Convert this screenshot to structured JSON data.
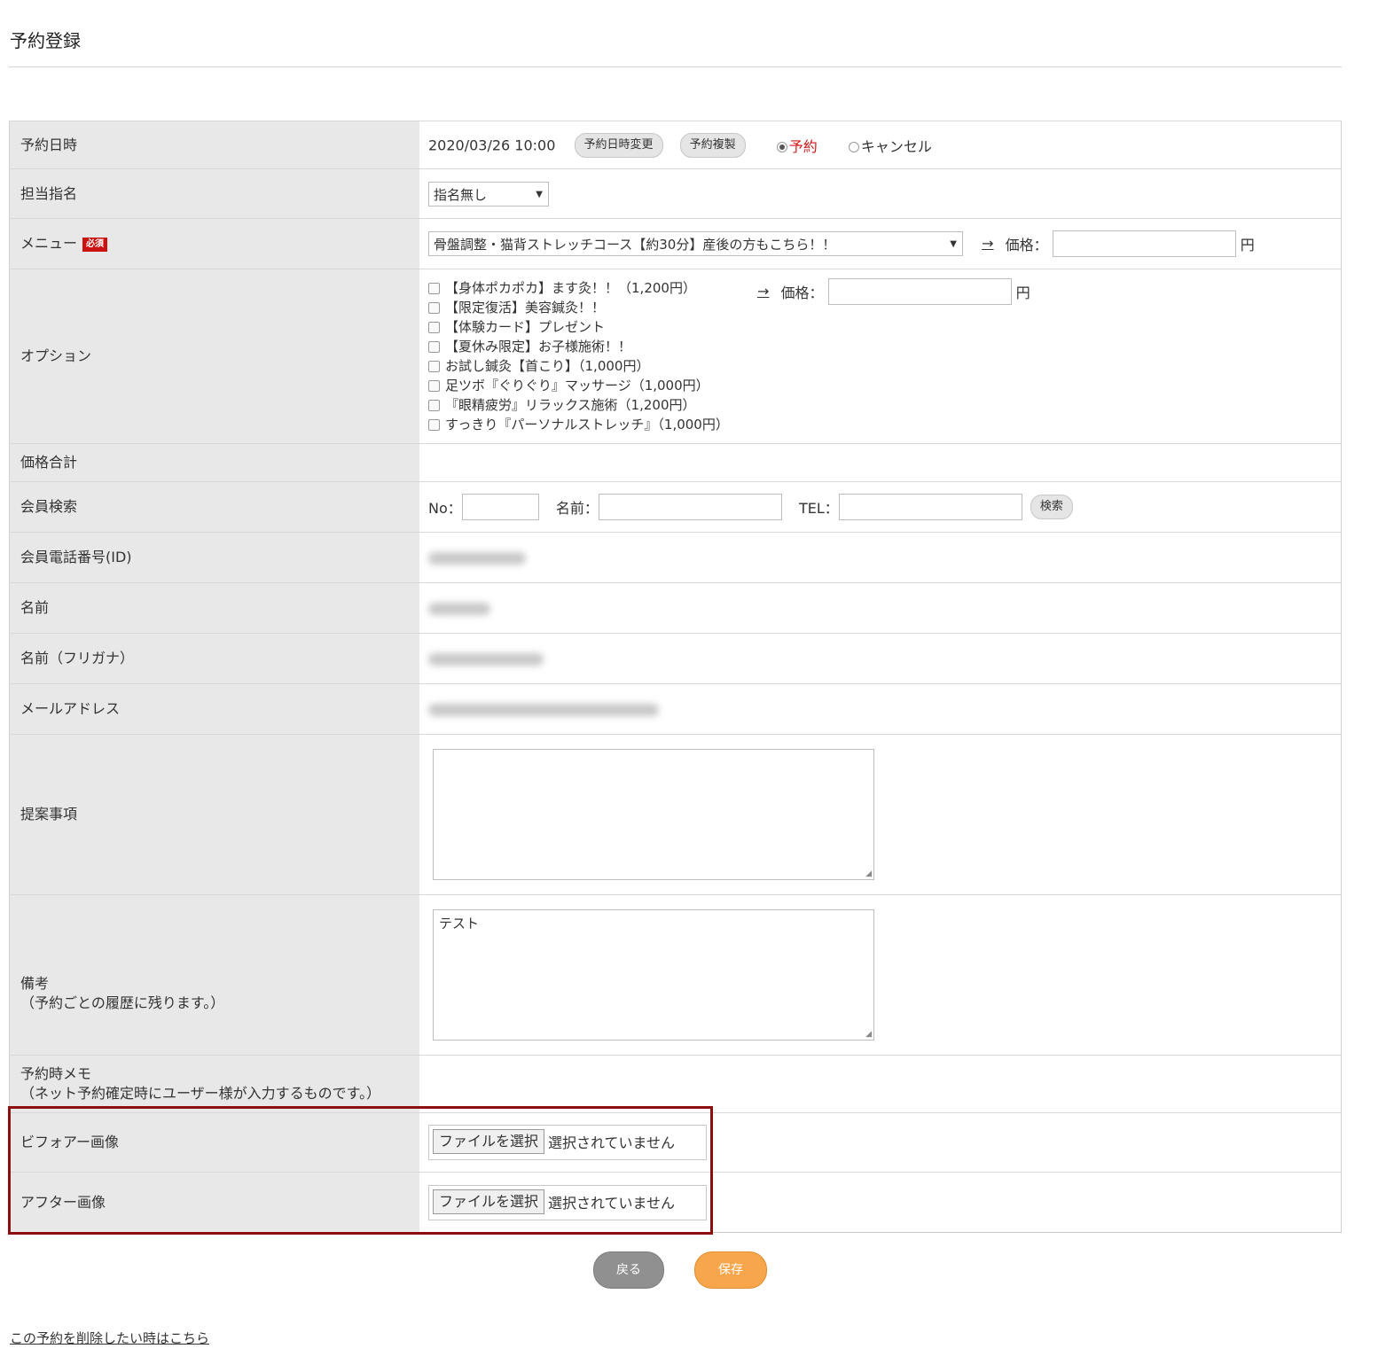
{
  "page": {
    "title": "予約登録"
  },
  "rows": {
    "datetime": {
      "label": "予約日時",
      "value": "2020/03/26 10:00",
      "change_btn": "予約日時変更",
      "copy_btn": "予約複製",
      "radio_reserve": "予約",
      "radio_cancel": "キャンセル"
    },
    "staff": {
      "label": "担当指名",
      "selected": "指名無し"
    },
    "menu": {
      "label": "メニュー",
      "required_badge": "必須",
      "selected": "骨盤調整・猫背ストレッチコース【約30分】産後の方もこちら！！",
      "arrow": "→",
      "price_label": "価格：",
      "yen": "円"
    },
    "option": {
      "label": "オプション",
      "arrow": "→",
      "price_label": "価格：",
      "yen": "円",
      "items": [
        "【身体ポカポカ】ます灸！！（1,200円）",
        "【限定復活】美容鍼灸！！",
        "【体験カード】プレゼント",
        "【夏休み限定】お子様施術！！",
        "お試し鍼灸【首こり】（1,000円）",
        "足ツボ『ぐりぐり』マッサージ（1,000円）",
        "『眼精疲労』リラックス施術（1,200円）",
        "すっきり『パーソナルストレッチ』（1,000円）"
      ]
    },
    "total": {
      "label": "価格合計"
    },
    "member_search": {
      "label": "会員検索",
      "no_label": "No：",
      "name_label": "名前：",
      "tel_label": "TEL：",
      "search_btn": "検索"
    },
    "member_tel": {
      "label": "会員電話番号(ID)"
    },
    "name": {
      "label": "名前"
    },
    "kana": {
      "label": "名前（フリガナ）"
    },
    "email": {
      "label": "メールアドレス"
    },
    "proposal": {
      "label": "提案事項",
      "value": ""
    },
    "remarks": {
      "label_line1": "備考",
      "label_line2": "（予約ごとの履歴に残ります。）",
      "value": "テスト"
    },
    "memo": {
      "label_line1": "予約時メモ",
      "label_line2": "（ネット予約確定時にユーザー様が入力するものです。）"
    },
    "before_image": {
      "label": "ビフォアー画像",
      "btn": "ファイルを選択",
      "status": "選択されていません"
    },
    "after_image": {
      "label": "アフター画像",
      "btn": "ファイルを選択",
      "status": "選択されていません"
    }
  },
  "actions": {
    "back": "戻る",
    "save": "保存",
    "delete_link": "この予約を削除したい時はこちら"
  },
  "colors": {
    "accent_save": "#f7a64c",
    "back_gray": "#909090",
    "required_red": "#cc1111",
    "highlight": "#8b0f0f"
  }
}
